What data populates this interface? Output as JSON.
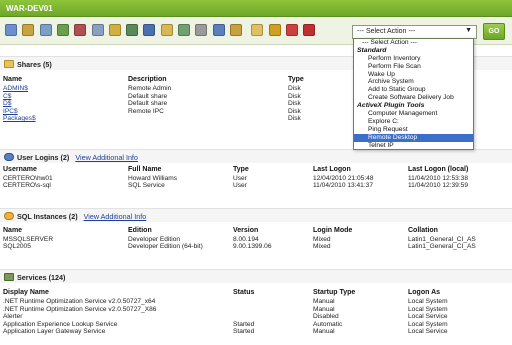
{
  "window": {
    "title": "WAR-DEV01"
  },
  "toolbar": {
    "icons": [
      "server-icon",
      "settings-icon",
      "tools-icon",
      "network-icon",
      "printer-icon",
      "user-icon",
      "group-icon",
      "process-icon",
      "monitor-icon",
      "folder-icon",
      "service-icon",
      "disk-icon",
      "window-icon",
      "script-icon",
      "notes-icon",
      "shield-icon",
      "report-icon",
      "pdf-icon"
    ],
    "select_value": "--- Select Action ---",
    "go_label": "GO"
  },
  "dropdown": {
    "items": [
      {
        "kind": "item",
        "label": "--- Select Action ---",
        "first": true
      },
      {
        "kind": "group",
        "label": "Standard"
      },
      {
        "kind": "item",
        "label": "Perform Inventory"
      },
      {
        "kind": "item",
        "label": "Perform File Scan"
      },
      {
        "kind": "item",
        "label": "Wake Up"
      },
      {
        "kind": "item",
        "label": "Archive System"
      },
      {
        "kind": "item",
        "label": "Add to Static Group"
      },
      {
        "kind": "item",
        "label": "Create Software Delivery Job"
      },
      {
        "kind": "group",
        "label": "ActiveX Plugin Tools"
      },
      {
        "kind": "item",
        "label": "Computer Management"
      },
      {
        "kind": "item",
        "label": "Explore C:"
      },
      {
        "kind": "item",
        "label": "Ping Request"
      },
      {
        "kind": "item",
        "label": "Remote Desktop",
        "selected": true
      },
      {
        "kind": "item",
        "label": "Telnet IP"
      }
    ]
  },
  "shares": {
    "title": "Shares (5)",
    "headers": [
      "Name",
      "Description",
      "Type"
    ],
    "rows": [
      [
        "ADMIN$",
        "Remote Admin",
        "Disk"
      ],
      [
        "C$",
        "Default share",
        "Disk"
      ],
      [
        "D$",
        "Default share",
        "Disk"
      ],
      [
        "IPC$",
        "Remote IPC",
        "Disk"
      ],
      [
        "Packages$",
        "",
        "Disk"
      ]
    ]
  },
  "user_logins": {
    "title": "User Logins (2)",
    "link": "View Additional Info",
    "headers": [
      "Username",
      "Full Name",
      "Type",
      "Last Logon",
      "Last Logon (local)"
    ],
    "rows": [
      [
        "CERTERO\\hw01",
        "Howard Williams",
        "User",
        "12/04/2010 21:05:48",
        "11/04/2010 12:53:38"
      ],
      [
        "CERTERO\\s-sql",
        "SQL Service",
        "User",
        "11/04/2010 13:41:37",
        "11/04/2010 12:39:59"
      ]
    ]
  },
  "sql_instances": {
    "title": "SQL Instances (2)",
    "link": "View Additional Info",
    "headers": [
      "Name",
      "Edition",
      "Version",
      "Login Mode",
      "Collation"
    ],
    "rows": [
      [
        "MSSQLSERVER",
        "Developer Edition",
        "8.00.194",
        "Mixed",
        "Latin1_General_CI_AS"
      ],
      [
        "SQL2005",
        "Developer Edition (64-bit)",
        "9.00.1399.06",
        "Mixed",
        "Latin1_General_CI_AS"
      ]
    ]
  },
  "services": {
    "title": "Services (124)",
    "headers": [
      "Display Name",
      "Status",
      "Startup Type",
      "Logon As"
    ],
    "rows": [
      [
        ".NET Runtime Optimization Service v2.0.50727_x64",
        "",
        "Manual",
        "Local System"
      ],
      [
        ".NET Runtime Optimization Service v2.0.50727_X86",
        "",
        "Manual",
        "Local System"
      ],
      [
        "Alerter",
        "",
        "Disabled",
        "Local Service"
      ],
      [
        "Application Experience Lookup Service",
        "Started",
        "Automatic",
        "Local System"
      ],
      [
        "Application Layer Gateway Service",
        "Started",
        "Manual",
        "Local Service"
      ]
    ]
  }
}
